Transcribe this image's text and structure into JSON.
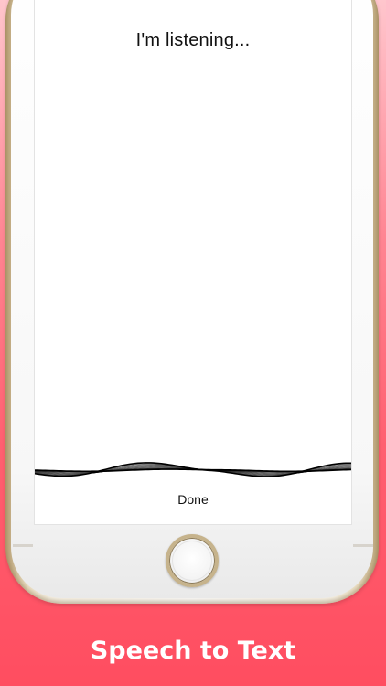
{
  "status": {
    "listening_text": "I'm listening..."
  },
  "actions": {
    "done_label": "Done"
  },
  "promo": {
    "caption": "Speech to Text"
  },
  "icons": {
    "voice_wave": "waveform-icon",
    "home": "home-button-icon"
  },
  "colors": {
    "background_top": "#ffc6cd",
    "background_bottom": "#ff4d60",
    "caption_text": "#ffffff",
    "screen": "#ffffff",
    "wave": "#000000"
  }
}
